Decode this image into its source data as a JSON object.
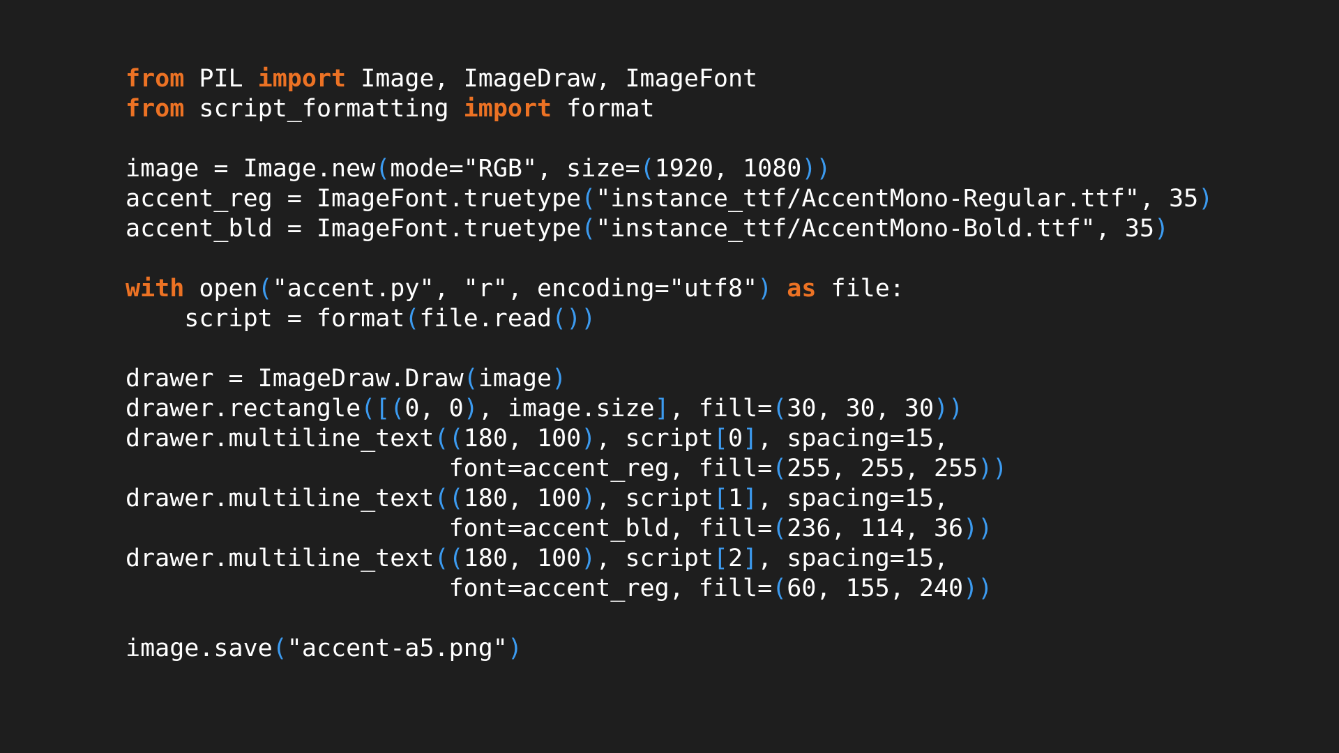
{
  "colors": {
    "background": "#1e1e1e",
    "text": "#ffffff",
    "keyword": "#ec7224",
    "bracket": "#3c9bf0"
  },
  "code_lines": [
    [
      {
        "t": "kw",
        "v": "from"
      },
      {
        "t": "text",
        "v": " PIL "
      },
      {
        "t": "kw",
        "v": "import"
      },
      {
        "t": "text",
        "v": " Image, ImageDraw, ImageFont"
      }
    ],
    [
      {
        "t": "kw",
        "v": "from"
      },
      {
        "t": "text",
        "v": " script_formatting "
      },
      {
        "t": "kw",
        "v": "import"
      },
      {
        "t": "text",
        "v": " format"
      }
    ],
    [],
    [
      {
        "t": "text",
        "v": "image = Image.new"
      },
      {
        "t": "br",
        "v": "("
      },
      {
        "t": "text",
        "v": "mode=\"RGB\", size="
      },
      {
        "t": "br",
        "v": "("
      },
      {
        "t": "text",
        "v": "1920, 1080"
      },
      {
        "t": "br",
        "v": "))"
      }
    ],
    [
      {
        "t": "text",
        "v": "accent_reg = ImageFont.truetype"
      },
      {
        "t": "br",
        "v": "("
      },
      {
        "t": "text",
        "v": "\"instance_ttf/AccentMono-Regular.ttf\", 35"
      },
      {
        "t": "br",
        "v": ")"
      }
    ],
    [
      {
        "t": "text",
        "v": "accent_bld = ImageFont.truetype"
      },
      {
        "t": "br",
        "v": "("
      },
      {
        "t": "text",
        "v": "\"instance_ttf/AccentMono-Bold.ttf\", 35"
      },
      {
        "t": "br",
        "v": ")"
      }
    ],
    [],
    [
      {
        "t": "kw",
        "v": "with"
      },
      {
        "t": "text",
        "v": " open"
      },
      {
        "t": "br",
        "v": "("
      },
      {
        "t": "text",
        "v": "\"accent.py\", \"r\", encoding=\"utf8\""
      },
      {
        "t": "br",
        "v": ")"
      },
      {
        "t": "text",
        "v": " "
      },
      {
        "t": "kw",
        "v": "as"
      },
      {
        "t": "text",
        "v": " file:"
      }
    ],
    [
      {
        "t": "text",
        "v": "    script = format"
      },
      {
        "t": "br",
        "v": "("
      },
      {
        "t": "text",
        "v": "file.read"
      },
      {
        "t": "br",
        "v": "())"
      }
    ],
    [],
    [
      {
        "t": "text",
        "v": "drawer = ImageDraw.Draw"
      },
      {
        "t": "br",
        "v": "("
      },
      {
        "t": "text",
        "v": "image"
      },
      {
        "t": "br",
        "v": ")"
      }
    ],
    [
      {
        "t": "text",
        "v": "drawer.rectangle"
      },
      {
        "t": "br",
        "v": "([("
      },
      {
        "t": "text",
        "v": "0, 0"
      },
      {
        "t": "br",
        "v": ")"
      },
      {
        "t": "text",
        "v": ", image.size"
      },
      {
        "t": "br",
        "v": "]"
      },
      {
        "t": "text",
        "v": ", fill="
      },
      {
        "t": "br",
        "v": "("
      },
      {
        "t": "text",
        "v": "30, 30, 30"
      },
      {
        "t": "br",
        "v": "))"
      }
    ],
    [
      {
        "t": "text",
        "v": "drawer.multiline_text"
      },
      {
        "t": "br",
        "v": "(("
      },
      {
        "t": "text",
        "v": "180, 100"
      },
      {
        "t": "br",
        "v": ")"
      },
      {
        "t": "text",
        "v": ", script"
      },
      {
        "t": "br",
        "v": "["
      },
      {
        "t": "text",
        "v": "0"
      },
      {
        "t": "br",
        "v": "]"
      },
      {
        "t": "text",
        "v": ", spacing=15,"
      }
    ],
    [
      {
        "t": "text",
        "v": "                      font=accent_reg, fill="
      },
      {
        "t": "br",
        "v": "("
      },
      {
        "t": "text",
        "v": "255, 255, 255"
      },
      {
        "t": "br",
        "v": "))"
      }
    ],
    [
      {
        "t": "text",
        "v": "drawer.multiline_text"
      },
      {
        "t": "br",
        "v": "(("
      },
      {
        "t": "text",
        "v": "180, 100"
      },
      {
        "t": "br",
        "v": ")"
      },
      {
        "t": "text",
        "v": ", script"
      },
      {
        "t": "br",
        "v": "["
      },
      {
        "t": "text",
        "v": "1"
      },
      {
        "t": "br",
        "v": "]"
      },
      {
        "t": "text",
        "v": ", spacing=15,"
      }
    ],
    [
      {
        "t": "text",
        "v": "                      font=accent_bld, fill="
      },
      {
        "t": "br",
        "v": "("
      },
      {
        "t": "text",
        "v": "236, 114, 36"
      },
      {
        "t": "br",
        "v": "))"
      }
    ],
    [
      {
        "t": "text",
        "v": "drawer.multiline_text"
      },
      {
        "t": "br",
        "v": "(("
      },
      {
        "t": "text",
        "v": "180, 100"
      },
      {
        "t": "br",
        "v": ")"
      },
      {
        "t": "text",
        "v": ", script"
      },
      {
        "t": "br",
        "v": "["
      },
      {
        "t": "text",
        "v": "2"
      },
      {
        "t": "br",
        "v": "]"
      },
      {
        "t": "text",
        "v": ", spacing=15,"
      }
    ],
    [
      {
        "t": "text",
        "v": "                      font=accent_reg, fill="
      },
      {
        "t": "br",
        "v": "("
      },
      {
        "t": "text",
        "v": "60, 155, 240"
      },
      {
        "t": "br",
        "v": "))"
      }
    ],
    [],
    [
      {
        "t": "text",
        "v": "image.save"
      },
      {
        "t": "br",
        "v": "("
      },
      {
        "t": "text",
        "v": "\"accent-a5.png\""
      },
      {
        "t": "br",
        "v": ")"
      }
    ]
  ]
}
